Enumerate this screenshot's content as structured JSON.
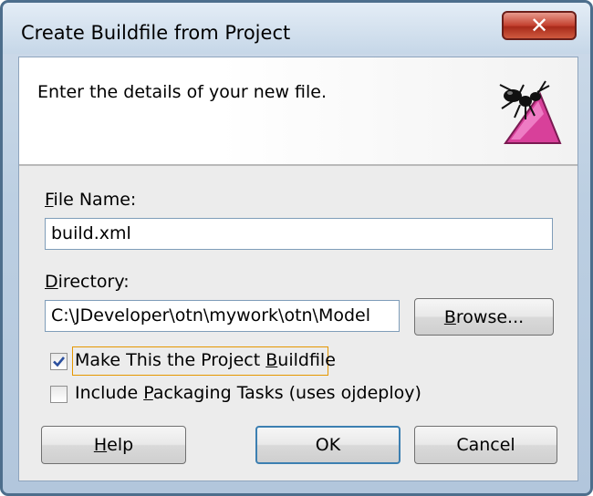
{
  "window": {
    "title": "Create Buildfile from Project",
    "close_glyph": "✕"
  },
  "header": {
    "instruction": "Enter the details of your new file.",
    "logo_icon": "ant-logo-icon"
  },
  "file_name": {
    "label_mnemonic": "F",
    "label_rest": "ile Name:",
    "value": "build.xml"
  },
  "directory": {
    "label_mnemonic": "D",
    "label_rest": "irectory:",
    "value": "C:\\JDeveloper\\otn\\mywork\\otn\\Model",
    "browse_label_mnemonic": "B",
    "browse_label_rest": "rowse..."
  },
  "options": {
    "make_project_buildfile": {
      "label_pre": "Make This the Project ",
      "label_mnemonic": "B",
      "label_post": "uildfile",
      "checked": true
    },
    "include_packaging": {
      "label_pre": "Include ",
      "label_mnemonic": "P",
      "label_post": "ackaging Tasks (uses ojdeploy)",
      "checked": false
    }
  },
  "buttons": {
    "help_mnemonic": "H",
    "help_rest": "elp",
    "ok": "OK",
    "cancel": "Cancel"
  },
  "colors": {
    "accent_focus": "#e59700",
    "default_button_border": "#3c7fb1",
    "close_red": "#c4412f"
  }
}
